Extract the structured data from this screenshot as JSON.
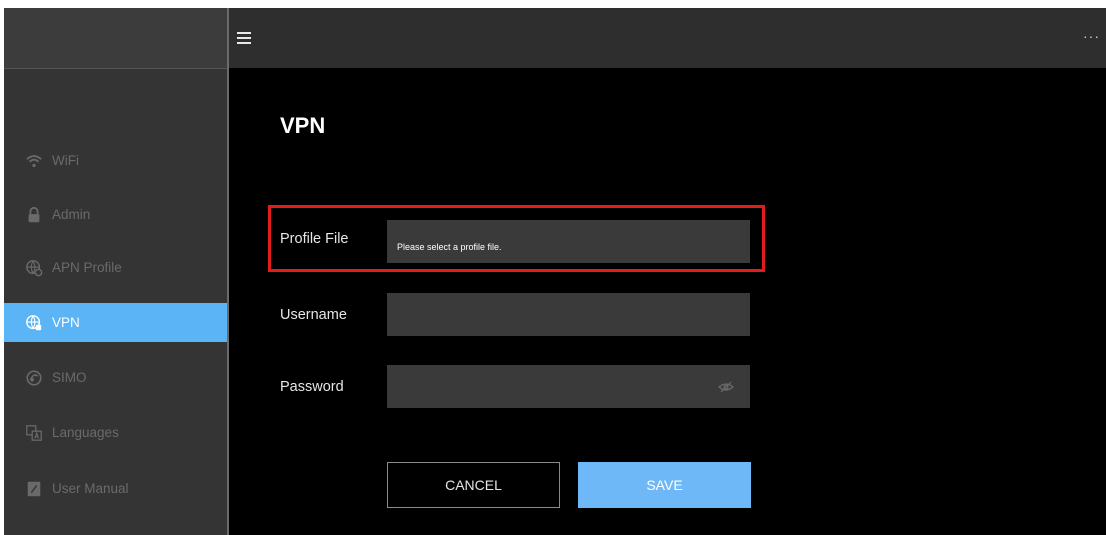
{
  "sidebar": {
    "items": [
      {
        "label": "WiFi",
        "icon": "wifi-icon",
        "active": false
      },
      {
        "label": "Admin",
        "icon": "lock-icon",
        "active": false
      },
      {
        "label": "APN Profile",
        "icon": "apn-profile-icon",
        "active": false
      },
      {
        "label": "VPN",
        "icon": "vpn-globe-icon",
        "active": true
      },
      {
        "label": "SIMO",
        "icon": "simo-icon",
        "active": false
      },
      {
        "label": "Languages",
        "icon": "languages-icon",
        "active": false
      },
      {
        "label": "User Manual",
        "icon": "user-manual-icon",
        "active": false
      }
    ]
  },
  "header": {
    "more_label": "···"
  },
  "main": {
    "title": "VPN",
    "profile_file": {
      "label": "Profile File",
      "placeholder": "Please select a profile file."
    },
    "username": {
      "label": "Username",
      "value": ""
    },
    "password": {
      "label": "Password",
      "value": ""
    },
    "cancel_label": "CANCEL",
    "save_label": "SAVE"
  },
  "colors": {
    "accent": "#5ab4f5",
    "highlight": "#e21b1b",
    "background": "#000000",
    "sidebar": "#343434"
  }
}
